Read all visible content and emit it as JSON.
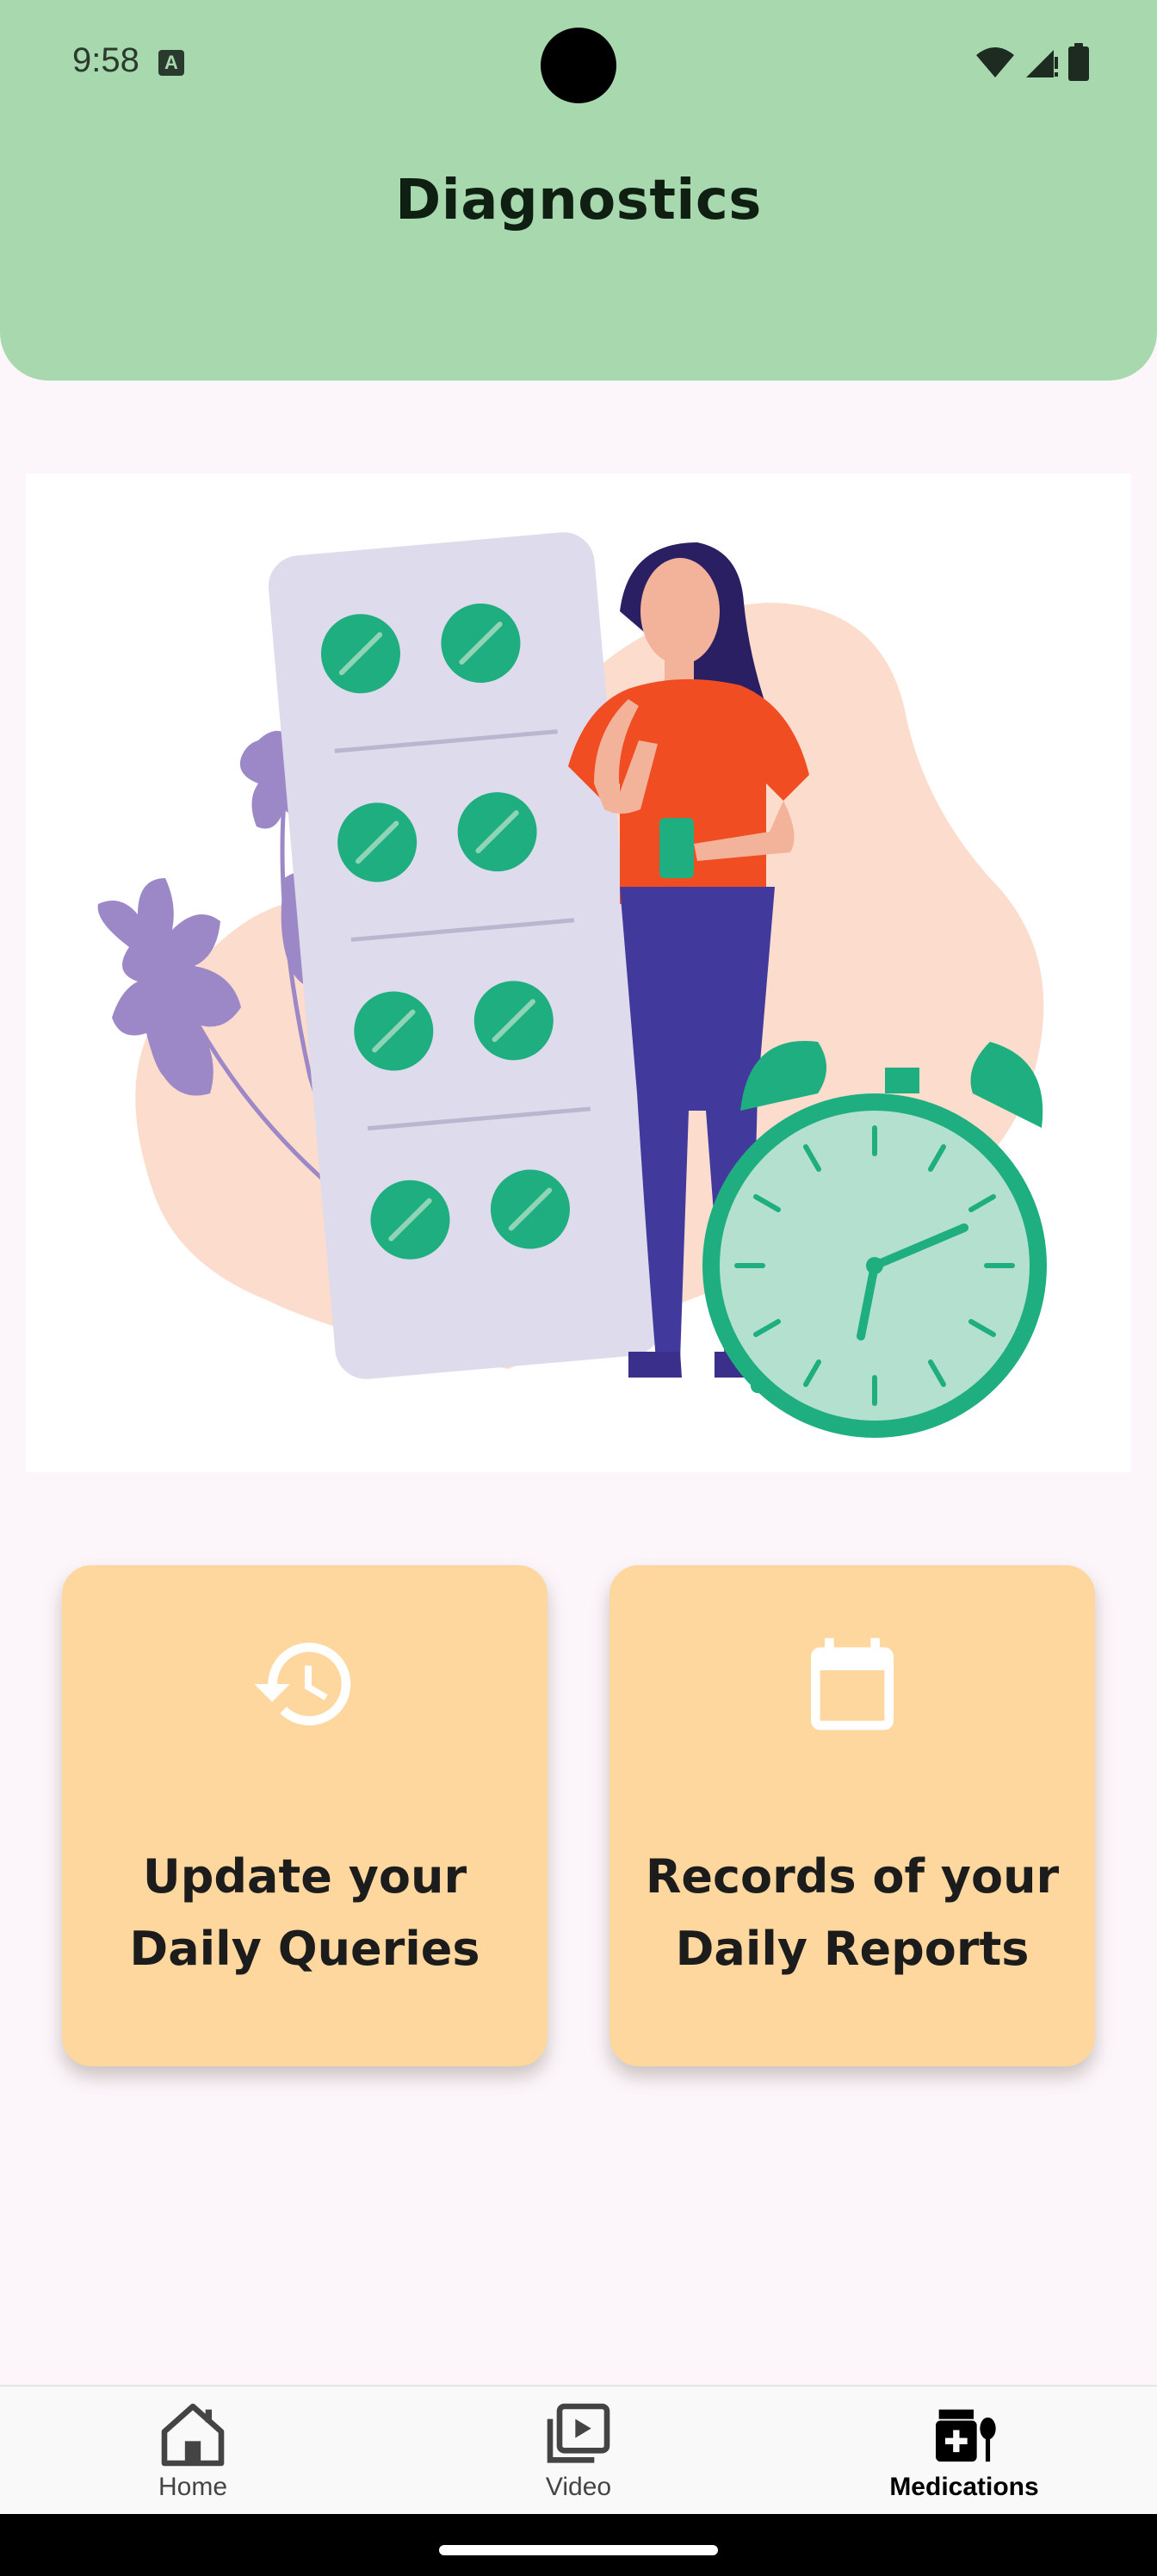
{
  "status_bar": {
    "time": "9:58",
    "notification_icon": "a-icon",
    "icons": [
      "wifi-icon",
      "signal-icon",
      "battery-icon"
    ]
  },
  "header": {
    "title": "Diagnostics",
    "background_color": "#a8d8ae"
  },
  "illustration": {
    "icon": "woman-with-medication-and-alarm-clock-illustration"
  },
  "cards": [
    {
      "label": "Update your Daily Queries",
      "icon": "history-icon"
    },
    {
      "label": "Records of your Daily Reports",
      "icon": "calendar-icon"
    }
  ],
  "card_color": "#fdd79d",
  "bottom_nav": {
    "items": [
      {
        "label": "Home",
        "icon": "home-icon",
        "active": false
      },
      {
        "label": "Video",
        "icon": "video-library-icon",
        "active": false
      },
      {
        "label": "Medications",
        "icon": "medications-icon",
        "active": true
      }
    ]
  }
}
